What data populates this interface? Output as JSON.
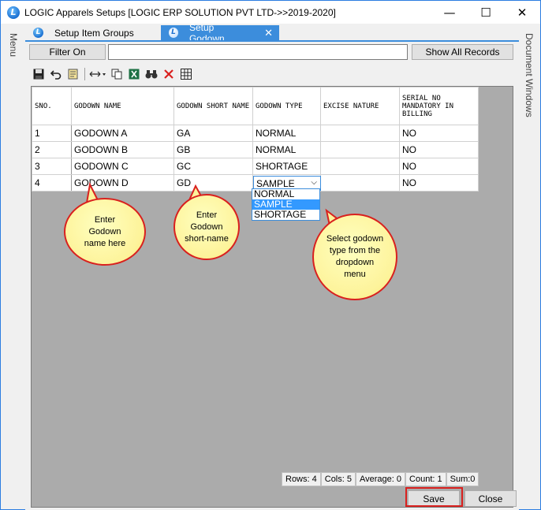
{
  "window": {
    "title": "LOGIC Apparels Setups  [LOGIC ERP SOLUTION PVT LTD->>2019-2020]",
    "minimize_glyph": "—",
    "maximize_glyph": "☐",
    "close_glyph": "✕"
  },
  "rails": {
    "left_label": "Menu",
    "right_label": "Document Windows"
  },
  "tabs": [
    {
      "label": "Setup Item Groups",
      "active": false
    },
    {
      "label": "Setup Godown",
      "active": true,
      "close_glyph": "✕"
    }
  ],
  "filter": {
    "label": "Filter On",
    "value": "",
    "show_all_label": "Show All Records"
  },
  "toolbar": {
    "icons": [
      "save-icon",
      "undo-icon",
      "edit-icon",
      "column-resize-icon",
      "copy-icon",
      "excel-icon",
      "find-icon",
      "delete-icon",
      "grid-icon"
    ]
  },
  "grid": {
    "headers": [
      "SNO.",
      "GODOWN NAME",
      "GODOWN SHORT NAME",
      "GODOWN TYPE",
      "EXCISE NATURE",
      "SERIAL NO MANDATORY IN BILLING"
    ],
    "rows": [
      {
        "sno": "1",
        "name": "GODOWN A",
        "short": "GA",
        "type": "NORMAL",
        "excise": "",
        "serial": "NO"
      },
      {
        "sno": "2",
        "name": "GODOWN B",
        "short": "GB",
        "type": "NORMAL",
        "excise": "",
        "serial": "NO"
      },
      {
        "sno": "3",
        "name": "GODOWN C",
        "short": "GC",
        "type": "SHORTAGE",
        "excise": "",
        "serial": "NO"
      },
      {
        "sno": "4",
        "name": "GODOWN D",
        "short": "GD",
        "type": "SAMPLE",
        "excise": "",
        "serial": "NO"
      }
    ],
    "dropdown_options": [
      "NORMAL",
      "SAMPLE",
      "SHORTAGE"
    ],
    "dropdown_selected": "SAMPLE"
  },
  "callouts": {
    "name": "Enter Godown name  here",
    "short": "Enter Godown short-name",
    "type": "Select godown  type from  the dropdown menu"
  },
  "status": {
    "rows": "Rows: 4",
    "cols": "Cols: 5",
    "average": "Average: 0",
    "count": "Count: 1",
    "sum": "Sum:0"
  },
  "actions": {
    "save_label": "Save",
    "close_label": "Close"
  },
  "colors": {
    "accent": "#3c8ddc",
    "callout_border": "#d9201e",
    "callout_fill": "#fdf39a"
  }
}
